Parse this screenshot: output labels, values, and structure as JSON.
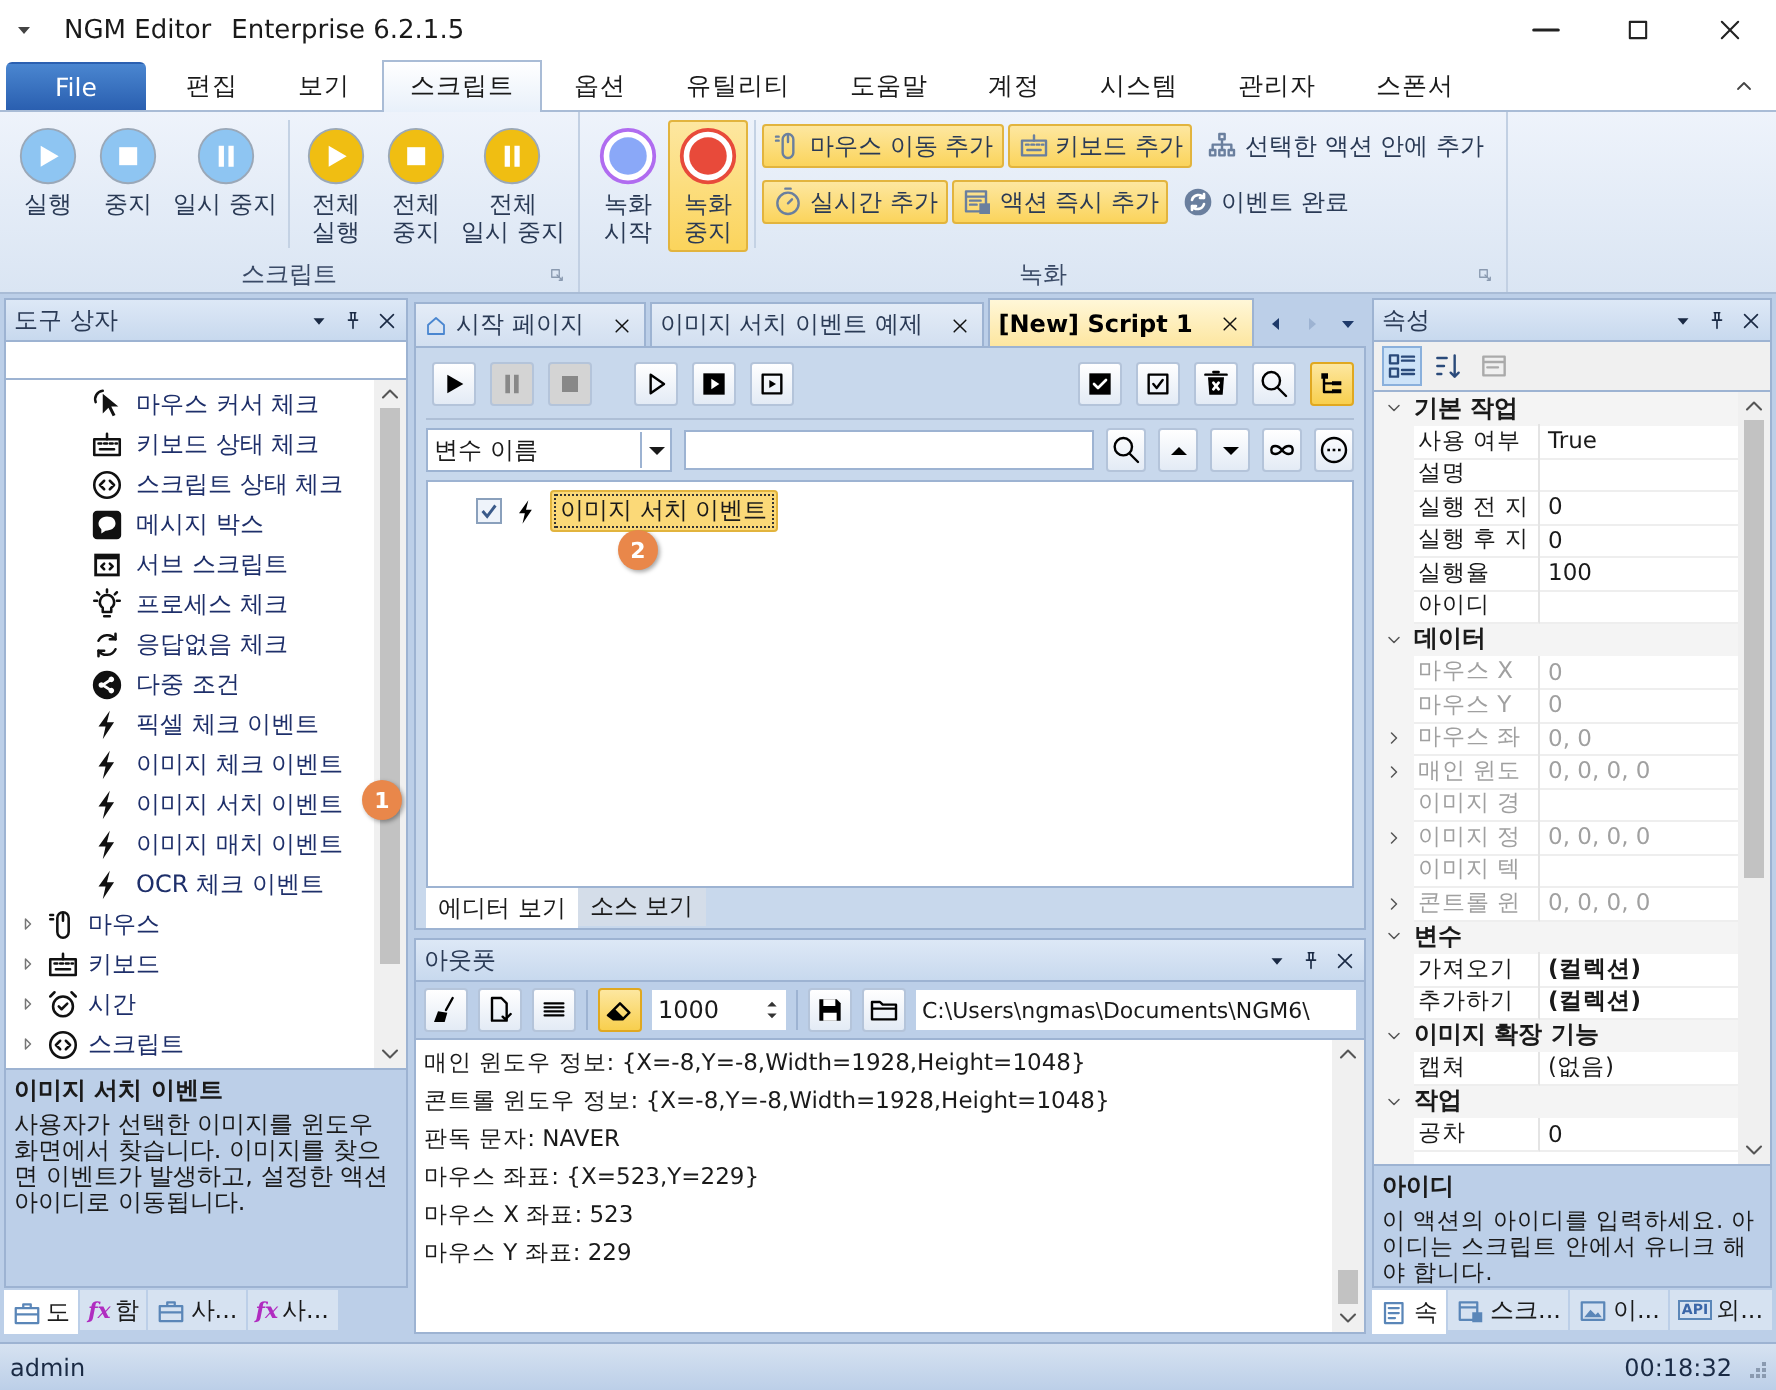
{
  "window": {
    "title": "NGM Editor",
    "edition": "Enterprise 6.2.1.5"
  },
  "ribbon_tabs": [
    {
      "label": "File",
      "kind": "file",
      "selected": false
    },
    {
      "label": "편집",
      "kind": "tab",
      "selected": false
    },
    {
      "label": "보기",
      "kind": "tab",
      "selected": false
    },
    {
      "label": "스크립트",
      "kind": "tab",
      "selected": true
    },
    {
      "label": "옵션",
      "kind": "tab",
      "selected": false
    },
    {
      "label": "유틸리티",
      "kind": "tab",
      "selected": false
    },
    {
      "label": "도움말",
      "kind": "tab",
      "selected": false
    },
    {
      "label": "계정",
      "kind": "tab",
      "selected": false
    },
    {
      "label": "시스템",
      "kind": "tab",
      "selected": false
    },
    {
      "label": "관리자",
      "kind": "tab",
      "selected": false
    },
    {
      "label": "스폰서",
      "kind": "tab",
      "selected": false
    }
  ],
  "ribbon": {
    "script_group": {
      "title": "스크립트",
      "buttons": [
        {
          "label": "실행",
          "kind": "play",
          "color": "#8ec5f2"
        },
        {
          "label": "중지",
          "kind": "stop",
          "color": "#8ec5f2"
        },
        {
          "label": "일시 중지",
          "kind": "pause",
          "color": "#8ec5f2"
        },
        {
          "label": "전체\n실행",
          "kind": "play",
          "color": "#f0be12"
        },
        {
          "label": "전체\n중지",
          "kind": "stop",
          "color": "#f0be12"
        },
        {
          "label": "전체\n일시 중지",
          "kind": "pause",
          "color": "#f0be12"
        }
      ]
    },
    "record_group": {
      "title": "녹화",
      "large_buttons": [
        {
          "label": "녹화\n시작",
          "kind": "record-start",
          "active": false
        },
        {
          "label": "녹화\n중지",
          "kind": "record-stop",
          "active": true
        }
      ],
      "small_rows": [
        [
          {
            "label": "마우스 이동 추가",
            "kind": "mouse",
            "highlighted": true
          },
          {
            "label": "키보드 추가",
            "kind": "keyboard",
            "highlighted": true
          },
          {
            "label": "선택한 액션 안에 추가",
            "kind": "hierarchy",
            "highlighted": false
          }
        ],
        [
          {
            "label": "실시간 추가",
            "kind": "stopwatch",
            "highlighted": true
          },
          {
            "label": "액션 즉시 추가",
            "kind": "form",
            "highlighted": true
          },
          {
            "label": "이벤트 완료",
            "kind": "sync",
            "highlighted": false
          }
        ]
      ]
    }
  },
  "toolbox": {
    "title": "도구 상자",
    "tree": [
      {
        "children": [
          {
            "label": "마우스 커서 체크",
            "kind": "cursor"
          },
          {
            "label": "키보드 상태 체크",
            "kind": "keyboard"
          },
          {
            "label": "스크립트 상태 체크",
            "kind": "code"
          },
          {
            "label": "메시지 박스",
            "kind": "message"
          },
          {
            "label": "서브 스크립트",
            "kind": "window"
          },
          {
            "label": "프로세스 체크",
            "kind": "bulb"
          },
          {
            "label": "응답없음 체크",
            "kind": "refresh"
          },
          {
            "label": "다중 조건",
            "kind": "share"
          },
          {
            "label": "픽셀 체크 이벤트",
            "kind": "bolt"
          },
          {
            "label": "이미지 체크 이벤트",
            "kind": "bolt"
          },
          {
            "label": "이미지 서치 이벤트",
            "kind": "bolt"
          },
          {
            "label": "이미지 매치 이벤트",
            "kind": "bolt"
          },
          {
            "label": "OCR 체크 이벤트",
            "kind": "bolt"
          }
        ]
      },
      {
        "label": "마우스",
        "kind": "mouse",
        "expanded": false
      },
      {
        "label": "키보드",
        "kind": "keyboard",
        "expanded": false
      },
      {
        "label": "시간",
        "kind": "alarm",
        "expanded": false
      },
      {
        "label": "스크립트",
        "kind": "code",
        "expanded": false
      }
    ],
    "callout": "1",
    "help": {
      "title": "이미지 서치 이벤트",
      "text": "사용자가 선택한 이미지를 윈도우 화면에서 찾습니다. 이미지를 찾으면 이벤트가 발생하고, 설정한 액션 아이디로 이동됩니다."
    },
    "bottom_tabs": [
      {
        "label": "도",
        "kind": "toolbox",
        "selected": true
      },
      {
        "label": "함",
        "symbol": "fx",
        "kind": "function",
        "selected": false
      },
      {
        "label": "사...",
        "kind": "toolbox",
        "selected": false
      },
      {
        "label": "사...",
        "symbol": "fx",
        "kind": "function",
        "selected": false
      }
    ]
  },
  "document_tabs": [
    {
      "label": "시작 페이지",
      "kind": "home",
      "selected": false
    },
    {
      "label": "이미지 서치 이벤트 예제",
      "kind": "doc",
      "selected": false
    },
    {
      "label": "[New] Script 1",
      "kind": "doc",
      "selected": true
    }
  ],
  "editor": {
    "toolbar_left": [
      {
        "kind": "play",
        "disabled": false
      },
      {
        "kind": "pause",
        "disabled": true
      },
      {
        "kind": "stop",
        "disabled": true
      },
      {
        "kind": "play-outline",
        "disabled": false
      },
      {
        "kind": "play-block",
        "disabled": false
      },
      {
        "kind": "play-frame",
        "disabled": false
      }
    ],
    "toolbar_right": [
      {
        "kind": "check-block"
      },
      {
        "kind": "checkbox"
      },
      {
        "kind": "trash"
      },
      {
        "kind": "zoom"
      }
    ],
    "layout_toggle": {
      "kind": "tree",
      "active": true
    },
    "filter": {
      "field": "변수 이름"
    },
    "filter_buttons": [
      {
        "kind": "search"
      },
      {
        "kind": "caret-up"
      },
      {
        "kind": "caret-down"
      },
      {
        "kind": "infinity"
      },
      {
        "kind": "more"
      }
    ],
    "script_tree": [
      {
        "label": "이미지 서치 이벤트",
        "kind": "bolt",
        "checked": true,
        "selected": true
      }
    ],
    "callout": "2",
    "view_tabs": [
      {
        "label": "에디터 보기",
        "selected": true
      },
      {
        "label": "소스 보기",
        "selected": false
      }
    ]
  },
  "output": {
    "title": "아웃풋",
    "tools_a": [
      {
        "kind": "broom"
      },
      {
        "kind": "file-check"
      },
      {
        "kind": "list"
      }
    ],
    "tools_b": [
      {
        "kind": "eraser",
        "active": true
      }
    ],
    "count": "1000",
    "tools_c": [
      {
        "kind": "save"
      },
      {
        "kind": "folder"
      }
    ],
    "path": "C:\\Users\\ngmas\\Documents\\NGM6\\",
    "lines": [
      "매인 윈도우 정보: {X=-8,Y=-8,Width=1928,Height=1048}",
      "콘트롤 윈도우 정보: {X=-8,Y=-8,Width=1928,Height=1048}",
      "판독 문자: NAVER",
      "마우스 좌표: {X=523,Y=229}",
      "마우스 X 좌표: 523",
      "마우스 Y 좌표: 229"
    ]
  },
  "properties": {
    "title": "속성",
    "toolbar": [
      {
        "kind": "categorized",
        "selected": true,
        "disabled": false
      },
      {
        "kind": "sort",
        "selected": false,
        "disabled": false
      },
      {
        "kind": "pages",
        "selected": false,
        "disabled": true
      }
    ],
    "categories": [
      {
        "label": "기본 작업",
        "expanded": true,
        "rows": [
          {
            "name": "사용 여부",
            "value": "True",
            "disabled": false,
            "expandable": false,
            "kind": "text"
          },
          {
            "name": "설명",
            "value": "",
            "disabled": false,
            "expandable": false,
            "kind": "text"
          },
          {
            "name": "실행 전 지",
            "value": "0",
            "disabled": false,
            "expandable": false,
            "kind": "text"
          },
          {
            "name": "실행 후 지",
            "value": "0",
            "disabled": false,
            "expandable": false,
            "kind": "text"
          },
          {
            "name": "실행율",
            "value": "100",
            "disabled": false,
            "expandable": false,
            "kind": "text"
          },
          {
            "name": "아이디",
            "value": "",
            "disabled": false,
            "expandable": false,
            "kind": "text"
          }
        ]
      },
      {
        "label": "데이터",
        "expanded": true,
        "rows": [
          {
            "name": "마우스 X",
            "value": "0",
            "disabled": true,
            "expandable": false,
            "kind": "text"
          },
          {
            "name": "마우스 Y",
            "value": "0",
            "disabled": true,
            "expandable": false,
            "kind": "text"
          },
          {
            "name": "마우스 좌",
            "value": "0, 0",
            "disabled": true,
            "expandable": true,
            "kind": "text"
          },
          {
            "name": "매인 윈도",
            "value": "0, 0, 0, 0",
            "disabled": true,
            "expandable": true,
            "kind": "text"
          },
          {
            "name": "이미지 경",
            "value": "",
            "disabled": true,
            "expandable": false,
            "kind": "text"
          },
          {
            "name": "이미지 정",
            "value": "0, 0, 0, 0",
            "disabled": true,
            "expandable": true,
            "kind": "text"
          },
          {
            "name": "이미지 텍",
            "value": "",
            "disabled": true,
            "expandable": false,
            "kind": "text"
          },
          {
            "name": "콘트롤 윈",
            "value": "0, 0, 0, 0",
            "disabled": true,
            "expandable": true,
            "kind": "text"
          }
        ]
      },
      {
        "label": "변수",
        "expanded": true,
        "rows": [
          {
            "name": "가져오기",
            "value": "(컬렉션)",
            "disabled": false,
            "expandable": false,
            "kind": "collection"
          },
          {
            "name": "추가하기",
            "value": "(컬렉션)",
            "disabled": false,
            "expandable": false,
            "kind": "collection"
          }
        ]
      },
      {
        "label": "이미지 확장 기능",
        "expanded": true,
        "rows": [
          {
            "name": "캡쳐",
            "value": "(없음)",
            "disabled": false,
            "expandable": false,
            "kind": "text"
          }
        ]
      },
      {
        "label": "작업",
        "expanded": true,
        "rows": [
          {
            "name": "공차",
            "value": "0",
            "disabled": false,
            "expandable": false,
            "kind": "text"
          }
        ]
      }
    ],
    "help": {
      "title": "아이디",
      "text": "이 액션의 아이디를 입력하세요. 아이디는 스크립트 안에서 유니크 해야 합니다."
    },
    "bottom_tabs": [
      {
        "label": "속",
        "kind": "property",
        "selected": true
      },
      {
        "label": "스크...",
        "kind": "script",
        "selected": false
      },
      {
        "label": "이...",
        "kind": "image",
        "selected": false
      },
      {
        "label": "외...",
        "symbol": "API",
        "kind": "api",
        "selected": false
      }
    ]
  },
  "status_bar": {
    "user": "admin",
    "time": "00:18:32"
  }
}
